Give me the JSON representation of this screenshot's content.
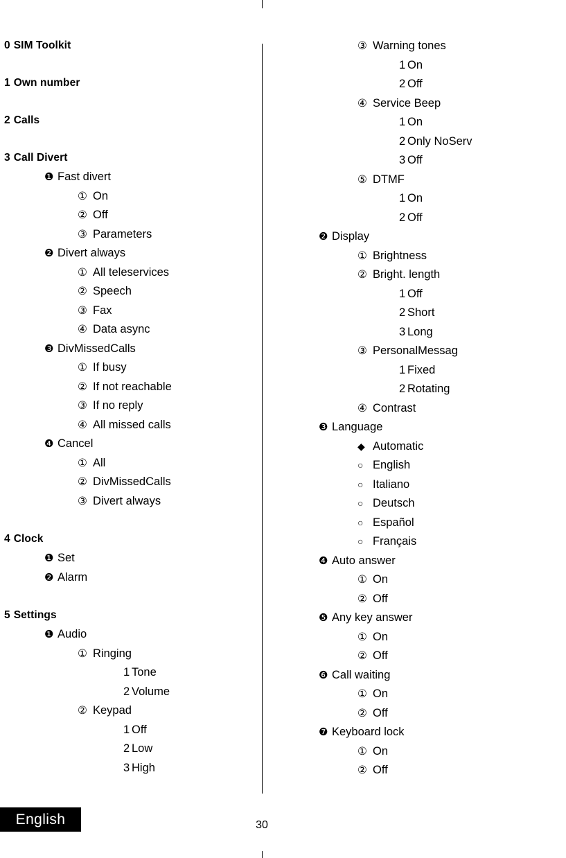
{
  "page": {
    "number": "30",
    "language_tab": "English"
  },
  "markers": {
    "disc1": "❶",
    "disc2": "❷",
    "disc3": "❸",
    "disc4": "❹",
    "disc5": "❺",
    "disc6": "❻",
    "disc7": "❼",
    "circ1": "①",
    "circ2": "②",
    "circ3": "③",
    "circ4": "④",
    "circ5": "⑤",
    "d1": "1",
    "d2": "2",
    "d3": "3",
    "diamond": "◆",
    "hollow": "○"
  },
  "left_column": {
    "headings": [
      {
        "num": "0",
        "label": "SIM Toolkit"
      },
      {
        "num": "1",
        "label": "Own number"
      },
      {
        "num": "2",
        "label": "Calls"
      },
      {
        "num": "3",
        "label": "Call Divert"
      },
      {
        "num": "4",
        "label": "Clock"
      },
      {
        "num": "5",
        "label": "Settings"
      }
    ],
    "call_divert": {
      "fast_divert": "Fast divert",
      "fast_divert_items": [
        "On",
        "Off",
        "Parameters"
      ],
      "divert_always": "Divert always",
      "divert_always_items": [
        "All teleservices",
        "Speech",
        "Fax",
        "Data async"
      ],
      "div_missed_calls": "DivMissedCalls",
      "div_missed_calls_items": [
        "If busy",
        "If not reachable",
        "If no reply",
        "All missed calls"
      ],
      "cancel": "Cancel",
      "cancel_items": [
        "All",
        "DivMissedCalls",
        "Divert always"
      ]
    },
    "clock": {
      "set": "Set",
      "alarm": "Alarm"
    },
    "settings": {
      "audio": "Audio",
      "ringing": "Ringing",
      "ringing_items": [
        "Tone",
        "Volume"
      ],
      "keypad": "Keypad",
      "keypad_items": [
        "Off",
        "Low",
        "High"
      ]
    }
  },
  "right_column": {
    "audio_cont": {
      "warning_tones": "Warning tones",
      "warning_tones_items": [
        "On",
        "Off"
      ],
      "service_beep": "Service Beep",
      "service_beep_items": [
        "On",
        "Only NoServ",
        "Off"
      ],
      "dtmf": "DTMF",
      "dtmf_items": [
        "On",
        "Off"
      ]
    },
    "display": {
      "label": "Display",
      "brightness": "Brightness",
      "bright_length": "Bright. length",
      "bright_length_items": [
        "Off",
        "Short",
        "Long"
      ],
      "personal_messag": "PersonalMessag",
      "personal_messag_items": [
        "Fixed",
        "Rotating"
      ],
      "contrast": "Contrast"
    },
    "language": {
      "label": "Language",
      "options": [
        "Automatic",
        "English",
        "Italiano",
        "Deutsch",
        "Español",
        "Français"
      ]
    },
    "auto_answer": {
      "label": "Auto answer",
      "items": [
        "On",
        "Off"
      ]
    },
    "any_key_answer": {
      "label": "Any key answer",
      "items": [
        "On",
        "Off"
      ]
    },
    "call_waiting": {
      "label": "Call waiting",
      "items": [
        "On",
        "Off"
      ]
    },
    "keyboard_lock": {
      "label": "Keyboard lock",
      "items": [
        "On",
        "Off"
      ]
    }
  }
}
